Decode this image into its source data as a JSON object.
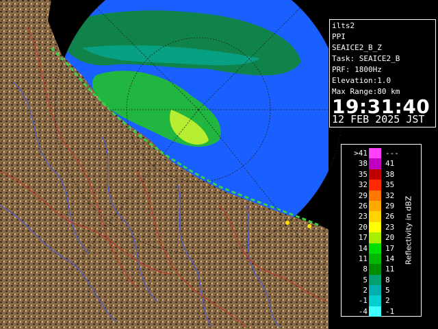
{
  "info": {
    "site": "ilts2",
    "mode": "PPI",
    "product": "SEAICE2_B_Z",
    "task": "Task: SEAICE2_B",
    "prf": "PRF: 1800Hz",
    "elevation": "Elevation:1.0",
    "max_range": "Max Range:80 km",
    "time": "19:31:40",
    "date": "12 FEB 2025 JST"
  },
  "legend": {
    "unit": "Reflectivity in dBZ",
    "rows": [
      {
        "lo": ">41",
        "hi": "---",
        "color": "#ff40ff"
      },
      {
        "lo": "38",
        "hi": "41",
        "color": "#c000c0"
      },
      {
        "lo": "35",
        "hi": "38",
        "color": "#c00000"
      },
      {
        "lo": "32",
        "hi": "35",
        "color": "#ff2a00"
      },
      {
        "lo": "29",
        "hi": "32",
        "color": "#ff7700"
      },
      {
        "lo": "26",
        "hi": "29",
        "color": "#ffaa00"
      },
      {
        "lo": "23",
        "hi": "26",
        "color": "#ffd400"
      },
      {
        "lo": "20",
        "hi": "23",
        "color": "#ffff00"
      },
      {
        "lo": "17",
        "hi": "20",
        "color": "#a8f000"
      },
      {
        "lo": "14",
        "hi": "17",
        "color": "#00e000"
      },
      {
        "lo": "11",
        "hi": "14",
        "color": "#00b800"
      },
      {
        "lo": "8",
        "hi": "11",
        "color": "#008c00"
      },
      {
        "lo": "5",
        "hi": "8",
        "color": "#00a070"
      },
      {
        "lo": "2",
        "hi": "5",
        "color": "#00b0b0"
      },
      {
        "lo": "-1",
        "hi": "2",
        "color": "#00d0d0"
      },
      {
        "lo": "-4",
        "hi": "-1",
        "color": "#40ffff"
      }
    ]
  },
  "map": {
    "sea_color": "#1a5fff",
    "land_color": "#8a6a44",
    "river_color": "#4a5ad0",
    "boundary_color": "#c83030"
  }
}
